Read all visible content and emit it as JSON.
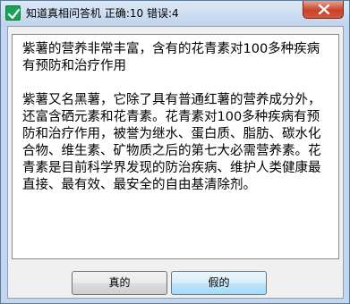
{
  "window": {
    "title": "知道真相问答机",
    "score": "正确:10 错误:4",
    "close_icon": "close-icon",
    "app_icon": "check-icon"
  },
  "content": {
    "question": "紫薯的营养非常丰富，含有的花青素对100多种疾病有预防和治疗作用",
    "explanation": "紫薯又名黑薯，它除了具有普通红薯的营养成分外，还富含硒元素和花青素。花青素对100多种疾病有预防和治疗作用，被誉为继水、蛋白质、脂肪、碳水化合物、维生素、矿物质之后的第七大必需营养素。花青素是目前科学界发现的防治疾病、维护人类健康最直接、最有效、最安全的自由基清除剂。"
  },
  "buttons": {
    "true_label": "真的",
    "false_label": "假的"
  }
}
